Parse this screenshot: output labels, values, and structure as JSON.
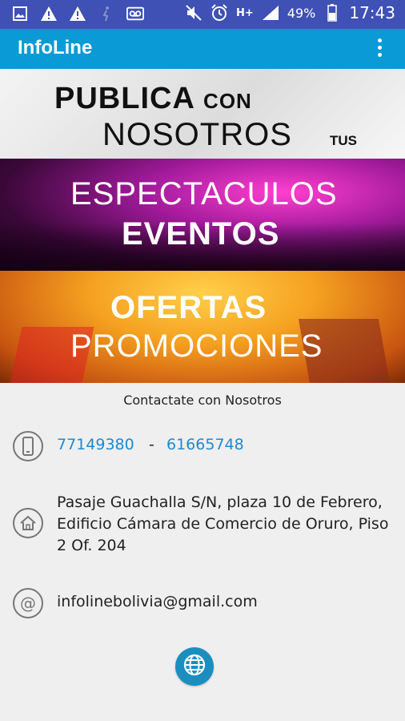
{
  "status_bar": {
    "battery": "49%",
    "time": "17:43",
    "network": "H+"
  },
  "app": {
    "title": "InfoLine"
  },
  "banners": {
    "publica": {
      "word1": "PUBLICA",
      "word2": "CON",
      "word3": "NOSOTROS",
      "word4": "TUS"
    },
    "espectaculos": {
      "line1": "ESPECTACULOS",
      "line2": "EVENTOS"
    },
    "ofertas": {
      "line1": "OFERTAS",
      "line2": "PROMOCIONES"
    }
  },
  "contact": {
    "title": "Contactate con Nosotros",
    "phone1": "77149380",
    "separator": "-",
    "phone2": "61665748",
    "address": "Pasaje Guachalla S/N, plaza 10 de Febrero, Edificio Cámara de Comercio de Oruro, Piso 2 Of. 204",
    "email": "infolinebolivia@gmail.com"
  },
  "icons": {
    "phone": "mobile-phone-icon",
    "home": "home-icon",
    "at": "at-sign-icon",
    "globe": "globe-icon"
  },
  "colors": {
    "status_bar": "#3f51b5",
    "app_bar": "#0a9ad6",
    "link": "#1f8ad2",
    "web_button": "#1a8fbf"
  }
}
